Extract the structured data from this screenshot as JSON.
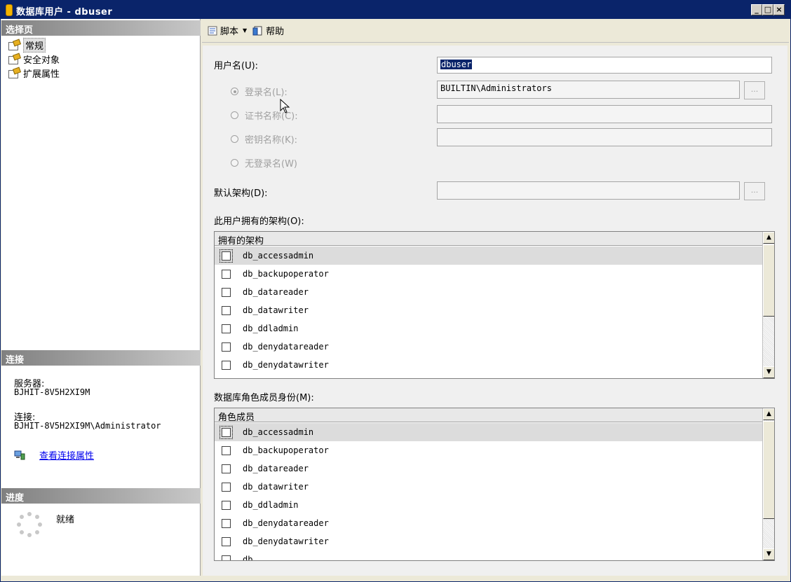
{
  "window": {
    "title": "数据库用户 - dbuser"
  },
  "left_pane": {
    "select_page_header": "选择页",
    "pages": [
      {
        "label": "常规",
        "icon": "page-properties-icon"
      },
      {
        "label": "安全对象",
        "icon": "page-properties-icon"
      },
      {
        "label": "扩展属性",
        "icon": "page-properties-icon"
      }
    ],
    "connection_header": "连接",
    "server_label": "服务器:",
    "server_value": "BJHIT-8V5H2XI9M",
    "connection_label": "连接:",
    "connection_value": "BJHIT-8V5H2XI9M\\Administrator",
    "view_connection_link": "查看连接属性",
    "progress_header": "进度",
    "progress_status": "就绪"
  },
  "toolbar": {
    "script_label": "脚本",
    "help_label": "帮助"
  },
  "form": {
    "username_label": "用户名(U):",
    "username_value": "dbuser",
    "login_name_label": "登录名(L):",
    "login_name_value": "BUILTIN\\Administrators",
    "cert_name_label": "证书名称(C):",
    "key_name_label": "密钥名称(K):",
    "no_login_label": "无登录名(W)",
    "default_schema_label": "默认架构(D):",
    "default_schema_value": "",
    "browse_label": "...",
    "owned_schemas_label": "此用户拥有的架构(O):",
    "role_membership_label": "数据库角色成员身份(M):"
  },
  "owned_schemas": {
    "header": "拥有的架构",
    "rows": [
      "db_accessadmin",
      "db_backupoperator",
      "db_datareader",
      "db_datawriter",
      "db_ddladmin",
      "db_denydatareader",
      "db_denydatawriter"
    ]
  },
  "role_members": {
    "header": "角色成员",
    "rows": [
      "db_accessadmin",
      "db_backupoperator",
      "db_datareader",
      "db_datawriter",
      "db_ddladmin",
      "db_denydatareader",
      "db_denydatawriter",
      "db"
    ]
  }
}
